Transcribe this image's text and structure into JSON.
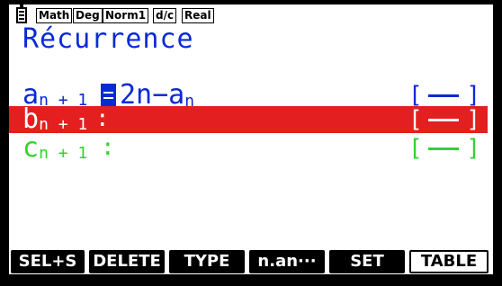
{
  "status_bar": {
    "icon": "battery-icon",
    "chips": [
      "Math",
      "Deg",
      "Norm1",
      "d/c",
      "Real"
    ]
  },
  "title": "Récurrence",
  "rows": [
    {
      "name_main": "a",
      "name_sub": "n + 1",
      "formula_main_1": "2n−a",
      "formula_sub": "n",
      "color": "#0a2ad6",
      "style": "solid"
    },
    {
      "name_main": "b",
      "name_sub": "n + 1",
      "colon": ":",
      "color": "#ffffff",
      "highlight": "#e31f1f",
      "style": "solid"
    },
    {
      "name_main": "c",
      "name_sub": "n + 1",
      "colon": ":",
      "color": "#31d331",
      "style": "solid"
    }
  ],
  "style_brackets": {
    "left": "[",
    "right": "]"
  },
  "function_keys": [
    "SEL+S",
    "DELETE",
    "TYPE",
    "n.an···",
    "SET",
    "TABLE"
  ]
}
